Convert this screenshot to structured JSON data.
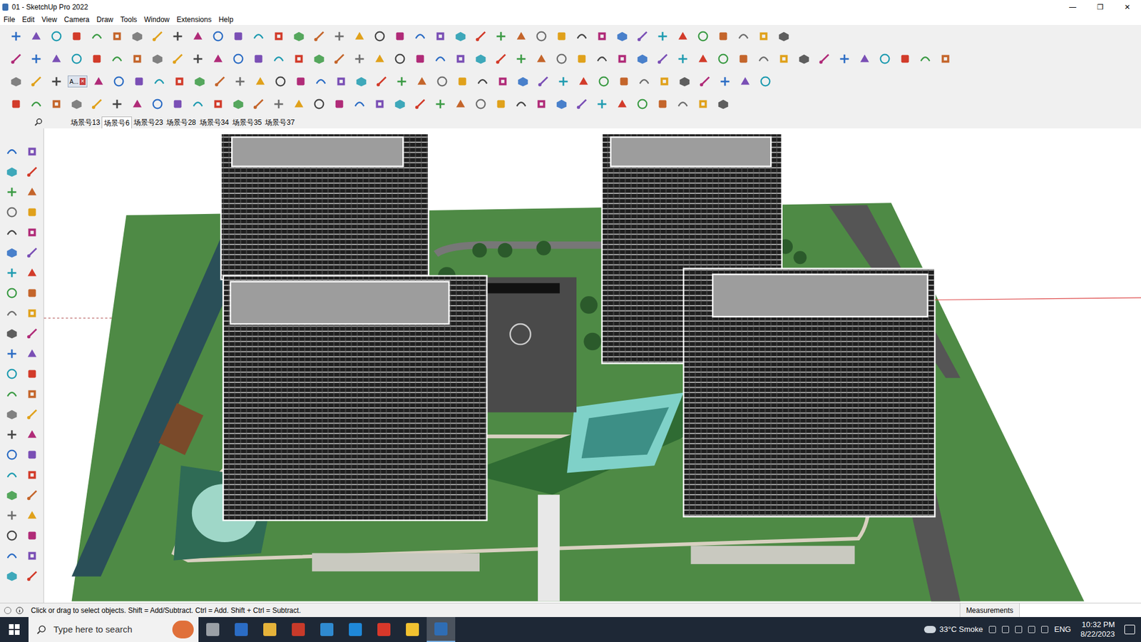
{
  "window": {
    "title": "01 - SketchUp Pro 2022",
    "controls": [
      "—",
      "❐",
      "✕"
    ]
  },
  "menu": [
    "File",
    "Edit",
    "View",
    "Camera",
    "Draw",
    "Tools",
    "Window",
    "Extensions",
    "Help"
  ],
  "toolbar_tag": {
    "label": "A...",
    "close": "×"
  },
  "scenes": [
    {
      "label": "场景号13",
      "selected": false
    },
    {
      "label": "场景号6",
      "selected": true
    },
    {
      "label": "场景号23",
      "selected": false
    },
    {
      "label": "场景号28",
      "selected": false
    },
    {
      "label": "场景号34",
      "selected": false
    },
    {
      "label": "场景号35",
      "selected": false
    },
    {
      "label": "场景号37",
      "selected": false
    }
  ],
  "status_bar": {
    "hint": "Click or drag to select objects. Shift = Add/Subtract. Ctrl = Add. Shift + Ctrl = Subtract.",
    "measurements_label": "Measurements"
  },
  "taskbar": {
    "search_placeholder": "Type here to search",
    "weather": "33°C Smoke",
    "language": "ENG",
    "time": "10:32 PM",
    "date": "8/22/2023"
  }
}
